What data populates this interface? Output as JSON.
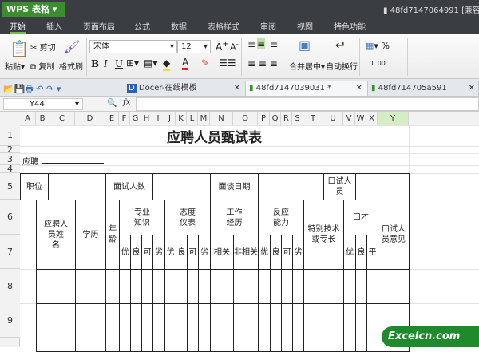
{
  "app": {
    "name": "WPS 表格",
    "doc_title": "48fd7147064991 [兼容"
  },
  "menu": [
    "开始",
    "插入",
    "页面布局",
    "公式",
    "数据",
    "表格样式",
    "审阅",
    "视图",
    "特色功能"
  ],
  "ribbon": {
    "paste": "粘贴",
    "cut": "剪切",
    "copy": "复制",
    "format_painter": "格式刷",
    "font": "宋体",
    "font_size": "12",
    "bold": "B",
    "italic": "I",
    "underline": "U",
    "merge_center": "合并居中",
    "wrap_text": "自动换行",
    "percent": "%"
  },
  "tabs": [
    {
      "label": "Docer-在线模板"
    },
    {
      "label": "48fd7147039031 *"
    },
    {
      "label": "48fd714705a591"
    }
  ],
  "formula": {
    "name_box": "Y44",
    "fx": "fx"
  },
  "columns": [
    "A",
    "B",
    "C",
    "D",
    "E",
    "F",
    "G",
    "H",
    "I",
    "J",
    "K",
    "L",
    "M",
    "N",
    "O",
    "P",
    "Q",
    "R",
    "S",
    "T",
    "U",
    "V",
    "W",
    "X",
    "Y"
  ],
  "rows": [
    "1",
    "2",
    "3",
    "4",
    "5",
    "6",
    "7",
    "8",
    "9"
  ],
  "sheet": {
    "title": "应聘人员甄试表",
    "apply_label": "应聘",
    "row5": [
      "职位",
      "面试人数",
      "面谈日期",
      "口试人员"
    ],
    "header": {
      "name": "应聘人员姓　　名",
      "education": "学历",
      "age": "年龄",
      "knowledge": "专业知识",
      "attitude": "态度仪表",
      "experience": "工作经历",
      "reaction": "反应能力",
      "special": "特别技术或专长",
      "eloquence": "口才",
      "opinion": "口试人员意见"
    },
    "grades4": [
      "优",
      "良",
      "可",
      "劣"
    ],
    "exp_sub": [
      "相关",
      "非相关"
    ],
    "grades3": [
      "优",
      "良",
      "平"
    ]
  },
  "watermark": "Excelcn.com"
}
